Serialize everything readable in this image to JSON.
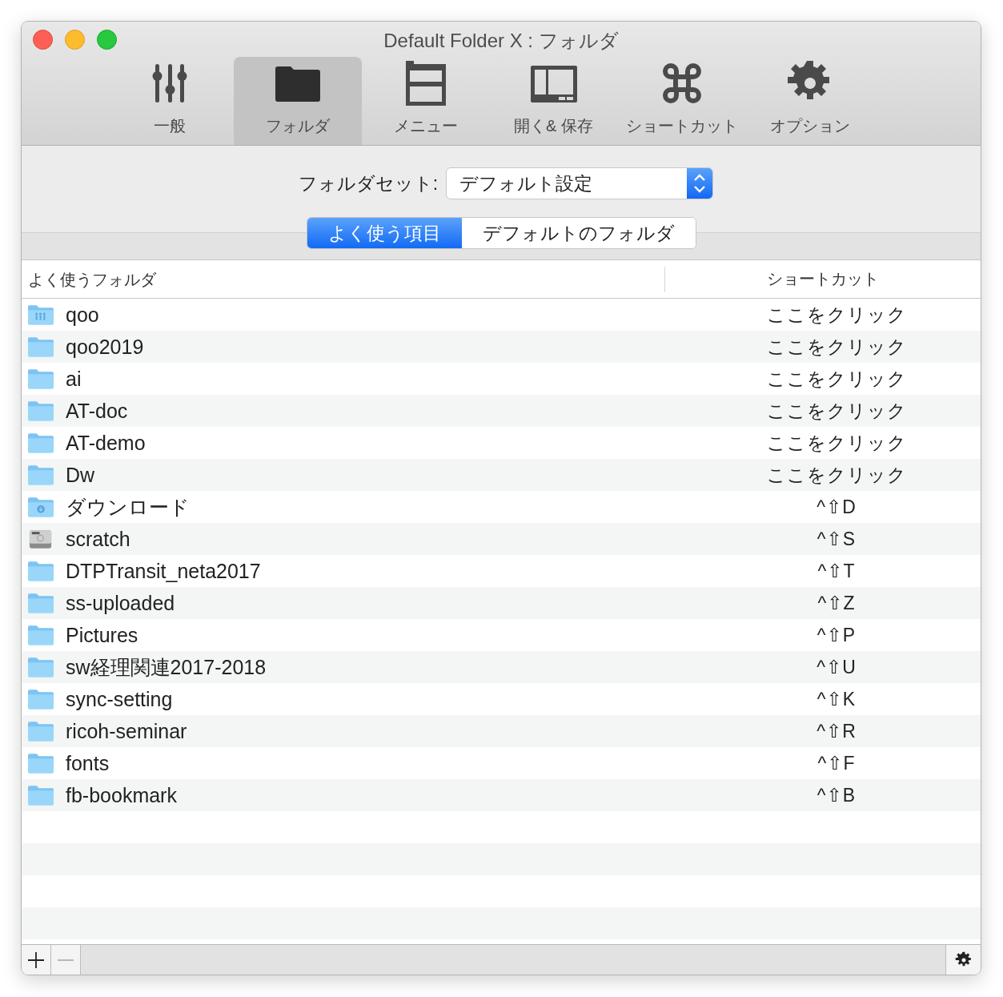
{
  "window": {
    "title": "Default Folder X : フォルダ"
  },
  "toolbar": [
    {
      "label": "一般",
      "selected": false
    },
    {
      "label": "フォルダ",
      "selected": true
    },
    {
      "label": "メニュー",
      "selected": false
    },
    {
      "label": "開く& 保存",
      "selected": false
    },
    {
      "label": "ショートカット",
      "selected": false
    },
    {
      "label": "オプション",
      "selected": false
    }
  ],
  "folder_set": {
    "label": "フォルダセット:",
    "value": "デフォルト設定"
  },
  "segments": [
    {
      "label": "よく使う項目",
      "selected": true
    },
    {
      "label": "デフォルトのフォルダ",
      "selected": false
    }
  ],
  "table": {
    "columns": [
      "よく使うフォルダ",
      "ショートカット"
    ],
    "rows": [
      {
        "kind": "group-folder",
        "name": "qoo",
        "shortcut": "ここをクリック"
      },
      {
        "kind": "folder",
        "name": "qoo2019",
        "shortcut": "ここをクリック"
      },
      {
        "kind": "folder",
        "name": "ai",
        "shortcut": "ここをクリック"
      },
      {
        "kind": "folder",
        "name": "AT-doc",
        "shortcut": "ここをクリック"
      },
      {
        "kind": "folder",
        "name": "AT-demo",
        "shortcut": "ここをクリック"
      },
      {
        "kind": "folder",
        "name": "Dw",
        "shortcut": "ここをクリック"
      },
      {
        "kind": "downloads-folder",
        "name": "ダウンロード",
        "shortcut": "^⇧D"
      },
      {
        "kind": "disk",
        "name": "scratch",
        "shortcut": "^⇧S"
      },
      {
        "kind": "folder",
        "name": "DTPTransit_neta2017",
        "shortcut": "^⇧T"
      },
      {
        "kind": "folder",
        "name": "ss-uploaded",
        "shortcut": "^⇧Z"
      },
      {
        "kind": "folder",
        "name": "Pictures",
        "shortcut": "^⇧P"
      },
      {
        "kind": "folder",
        "name": "sw経理関連2017-2018",
        "shortcut": "^⇧U"
      },
      {
        "kind": "folder",
        "name": "sync-setting",
        "shortcut": "^⇧K"
      },
      {
        "kind": "folder",
        "name": "ricoh-seminar",
        "shortcut": "^⇧R"
      },
      {
        "kind": "folder",
        "name": "fonts",
        "shortcut": "^⇧F"
      },
      {
        "kind": "folder",
        "name": "fb-bookmark",
        "shortcut": "^⇧B"
      }
    ]
  },
  "bottom_bar": {
    "add_disabled": false,
    "remove_disabled": true
  }
}
